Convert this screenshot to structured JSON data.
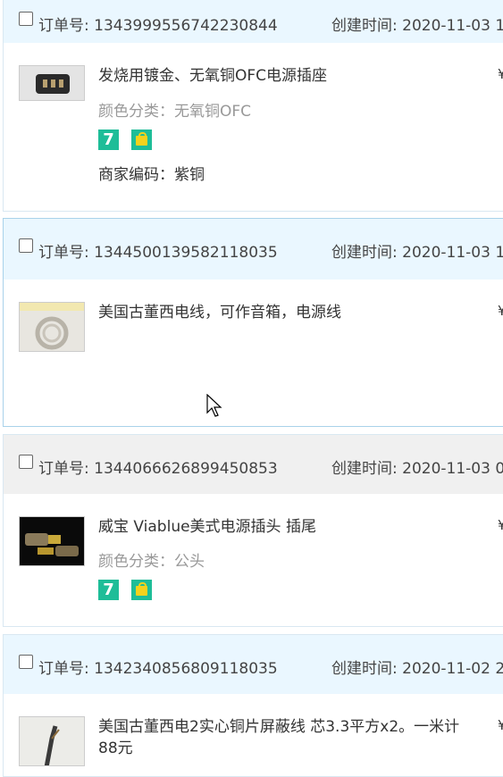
{
  "labels": {
    "order_prefix": "订单号:",
    "created_prefix": "创建时间:"
  },
  "orders": [
    {
      "order_no": "1343999556742230844",
      "created": "2020-11-03 1",
      "title": "发烧用镀金、无氧铜OFC电源插座",
      "color_class": "颜色分类：无氧铜OFC",
      "merchant_code": "商家编码：紫铜",
      "price_prefix": "¥"
    },
    {
      "order_no": "1344500139582118035",
      "created": "2020-11-03 1",
      "title": "美国古董西电线，可作音箱，电源线",
      "price_prefix": "¥"
    },
    {
      "order_no": "1344066626899450853",
      "created": "2020-11-03 0",
      "title": "威宝 Viablue美式电源插头 插尾",
      "color_class": "颜色分类：公头",
      "price_prefix": "¥"
    },
    {
      "order_no": "1342340856809118035",
      "created": "2020-11-02 2",
      "title": "美国古董西电2实心铜片屏蔽线 芯3.3平方x2。一米计88元",
      "price_prefix": "¥"
    }
  ],
  "badges": {
    "seven_day": "7",
    "service_icon": "shopping-bag-icon"
  },
  "colors": {
    "header_bg": "#eaf7ff",
    "header_bg_gray": "#f0f0f0",
    "badge_green": "#1ebd98",
    "secondary_text": "#999999"
  }
}
